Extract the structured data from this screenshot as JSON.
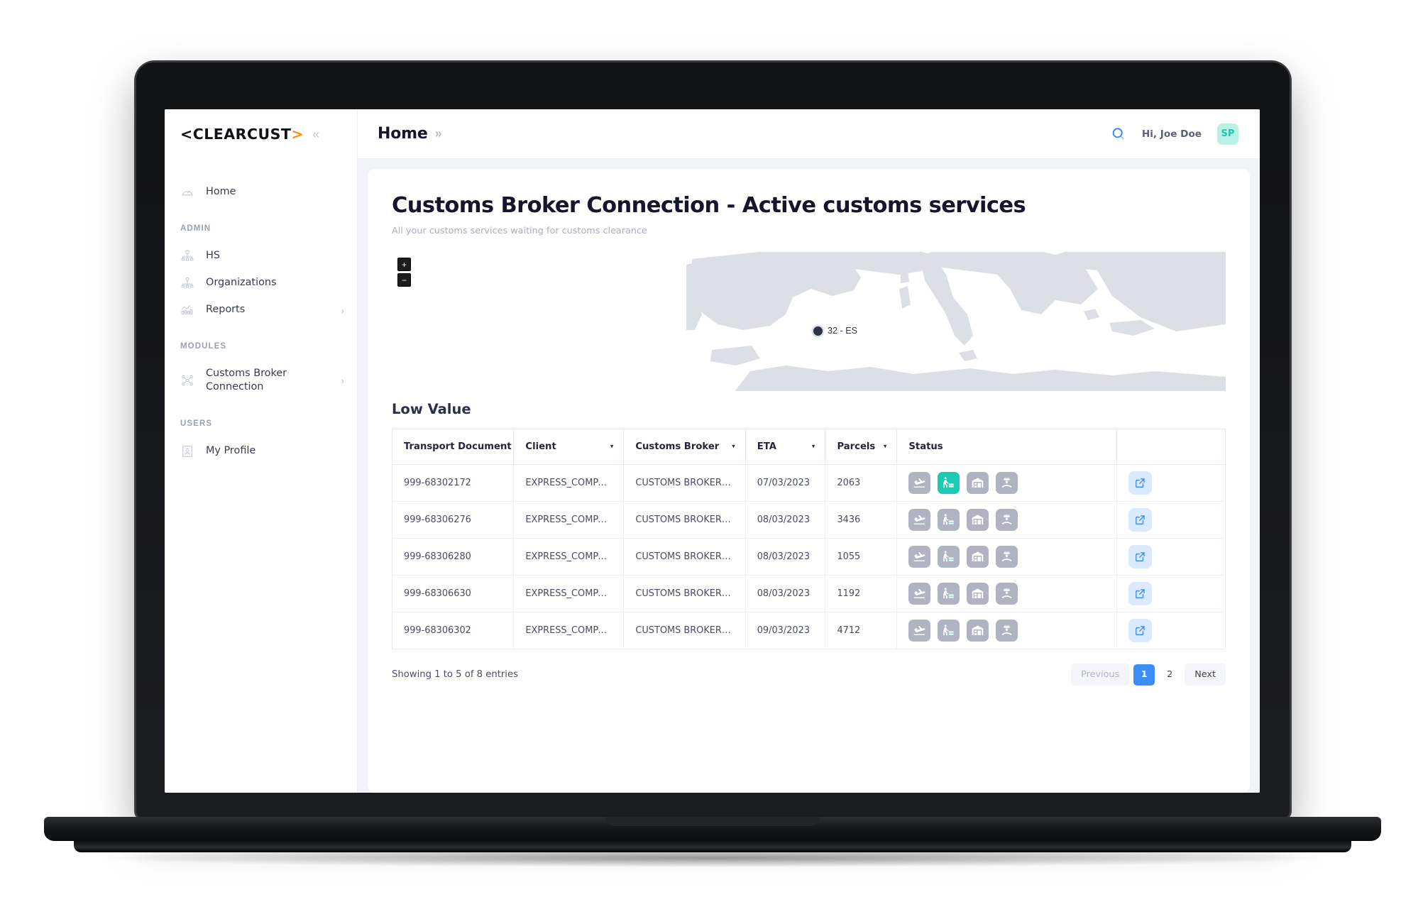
{
  "brand": {
    "logo_prefix": "<",
    "logo_name": "CLEARCUST",
    "logo_suffix": ">",
    "accent_color": "#f6921e",
    "collapse_glyph": "«"
  },
  "sidebar": {
    "items_top": [
      {
        "label": "Home",
        "icon": "speedometer-icon",
        "has_chevron": false
      }
    ],
    "sections": [
      {
        "label": "ADMIN",
        "items": [
          {
            "label": "HS",
            "icon": "org-tree-icon",
            "has_chevron": false
          },
          {
            "label": "Organizations",
            "icon": "org-tree-icon",
            "has_chevron": false
          },
          {
            "label": "Reports",
            "icon": "bar-chart-icon",
            "has_chevron": true,
            "chevron": "›"
          }
        ]
      },
      {
        "label": "MODULES",
        "items": [
          {
            "label": "Customs Broker Connection",
            "icon": "network-nodes-icon",
            "has_chevron": true,
            "chevron": "›"
          }
        ]
      },
      {
        "label": "USERS",
        "items": [
          {
            "label": "My Profile",
            "icon": "user-card-icon",
            "has_chevron": false
          }
        ]
      }
    ]
  },
  "topbar": {
    "breadcrumb": "Home",
    "breadcrumb_chevrons": "»",
    "search_icon": "search-icon",
    "greeting": "Hi, Joe Doe",
    "avatar_initials": "SP",
    "avatar_bg": "#b8f2e6",
    "avatar_color": "#1ec8b0"
  },
  "page": {
    "title": "Customs Broker Connection - Active customs services",
    "subtitle": "All your customs services waiting for customs clearance"
  },
  "map": {
    "zoom_in_label": "+",
    "zoom_out_label": "−",
    "marker_label": "32 - ES",
    "marker_color": "#2e3448",
    "land_color": "#dcdfe6"
  },
  "table": {
    "title": "Low Value",
    "columns": [
      {
        "label": "Transport Document",
        "sortable": true
      },
      {
        "label": "Client",
        "sortable": true
      },
      {
        "label": "Customs Broker",
        "sortable": true
      },
      {
        "label": "ETA",
        "sortable": true
      },
      {
        "label": "Parcels",
        "sortable": true
      },
      {
        "label": "Status",
        "sortable": false
      },
      {
        "label": "",
        "sortable": false
      }
    ],
    "sort_caret": "▾",
    "status_icon_names": [
      "plane-landing-icon",
      "loading-worker-icon",
      "warehouse-icon",
      "customs-officer-icon"
    ],
    "active_color": "#19cbb0",
    "inactive_color": "#b0b3c1",
    "open_icon_name": "external-link-icon",
    "rows": [
      {
        "transport_document": "999-68302172",
        "client": "EXPRESS_COMPANY",
        "customs_broker": "CUSTOMS BROKER SPAIN",
        "eta": "07/03/2023",
        "parcels": "2063",
        "status_active_index": 1
      },
      {
        "transport_document": "999-68306276",
        "client": "EXPRESS_COMPANY",
        "customs_broker": "CUSTOMS BROKER SPAIN",
        "eta": "08/03/2023",
        "parcels": "3436",
        "status_active_index": -1
      },
      {
        "transport_document": "999-68306280",
        "client": "EXPRESS_COMPANY",
        "customs_broker": "CUSTOMS BROKER SPAIN",
        "eta": "08/03/2023",
        "parcels": "1055",
        "status_active_index": -1
      },
      {
        "transport_document": "999-68306630",
        "client": "EXPRESS_COMPANY",
        "customs_broker": "CUSTOMS BROKER SPAIN",
        "eta": "08/03/2023",
        "parcels": "1192",
        "status_active_index": -1
      },
      {
        "transport_document": "999-68306302",
        "client": "EXPRESS_COMPANY",
        "customs_broker": "CUSTOMS BROKER SPAIN",
        "eta": "09/03/2023",
        "parcels": "4712",
        "status_active_index": -1
      }
    ]
  },
  "footer": {
    "showing_text": "Showing 1 to 5 of 8 entries",
    "previous_label": "Previous",
    "pages": [
      "1",
      "2"
    ],
    "current_page": "1",
    "next_label": "Next"
  }
}
